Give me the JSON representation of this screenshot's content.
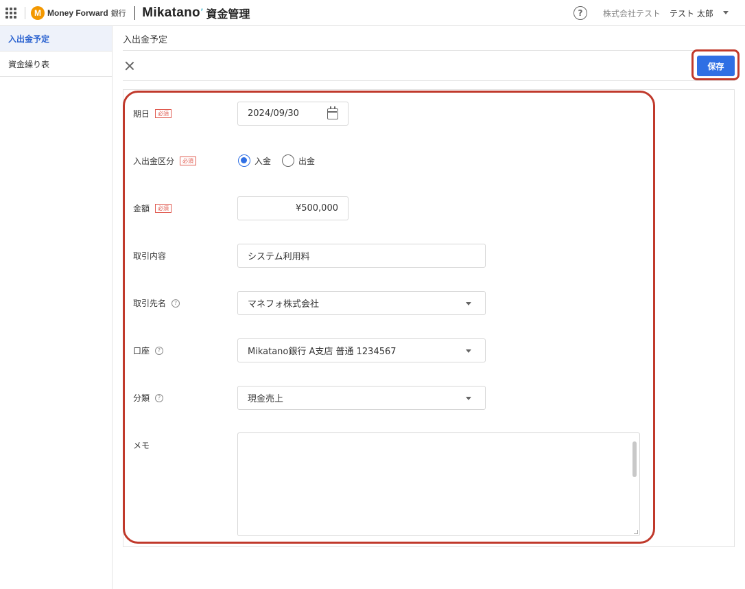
{
  "header": {
    "mf_logo_text": "Money Forward",
    "mf_bank": "銀行",
    "app_name": "Mikatano",
    "service_name": "資金管理",
    "help_symbol": "?",
    "company": "株式会社テスト",
    "user": "テスト 太郎"
  },
  "sidebar": {
    "items": [
      {
        "label": "入出金予定",
        "active": true
      },
      {
        "label": "資金繰り表",
        "active": false
      }
    ]
  },
  "page": {
    "title": "入出金予定",
    "save_label": "保存"
  },
  "form": {
    "required_tag": "必須",
    "date": {
      "label": "期日",
      "value": "2024/09/30"
    },
    "direction": {
      "label": "入出金区分",
      "options": [
        "入金",
        "出金"
      ],
      "selected": "入金"
    },
    "amount": {
      "label": "金額",
      "value": "¥500,000"
    },
    "description": {
      "label": "取引内容",
      "value": "システム利用料"
    },
    "partner": {
      "label": "取引先名",
      "value": "マネフォ株式会社"
    },
    "account": {
      "label": "口座",
      "value": "Mikatano銀行 A支店 普通 1234567"
    },
    "category": {
      "label": "分類",
      "value": "現金売上"
    },
    "memo": {
      "label": "メモ",
      "value": ""
    }
  },
  "colors": {
    "accent": "#2f6fe4",
    "highlight": "#c0392b",
    "required": "#e05a4f"
  }
}
